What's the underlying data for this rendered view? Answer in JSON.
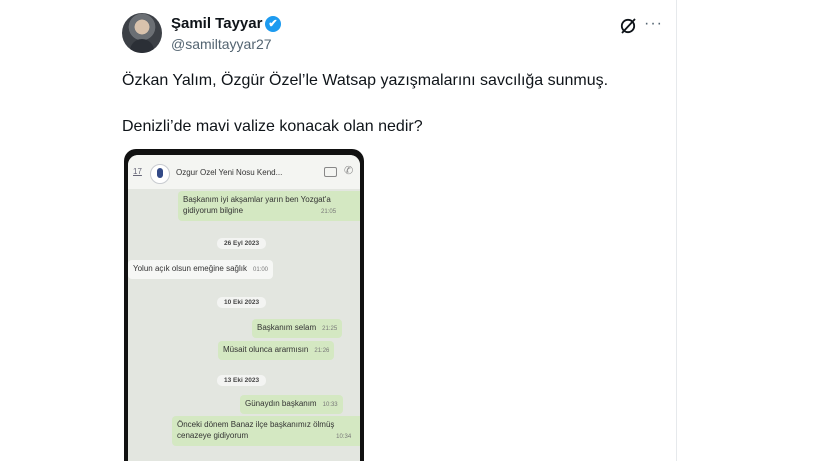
{
  "tweet": {
    "author_name": "Şamil Tayyar",
    "handle": "@samiltayyar27",
    "verified_mark": "✔",
    "more_label": "···",
    "text_line1": "Özkan Yalım, Özgür Özel’le Watsap yazışmalarını savcılığa sunmuş.",
    "text_line2": "Denizli’de mavi valize konacak olan nedir?"
  },
  "chat_screenshot": {
    "back_label": "17",
    "contact_title": "Ozgur Ozel Yeni Nosu Kend...",
    "messages": [
      {
        "kind": "out",
        "text1": "Başkanım iyi akşamlar yarın ben Yozgat'a",
        "text2": "gidiyorum bilgine",
        "time": "21:05"
      },
      {
        "kind": "date",
        "text": "26 Eyl 2023"
      },
      {
        "kind": "in",
        "text": "Yolun açık olsun emeğine sağlık",
        "time": "01:00"
      },
      {
        "kind": "date",
        "text": "10 Eki 2023"
      },
      {
        "kind": "out",
        "text": "Başkanım selam",
        "time": "21:25"
      },
      {
        "kind": "out",
        "text": "Müsait olunca ararmısın",
        "time": "21:26"
      },
      {
        "kind": "date",
        "text": "13 Eki 2023"
      },
      {
        "kind": "out",
        "text": "Günaydın başkanım",
        "time": "10:33"
      },
      {
        "kind": "out",
        "text1": "Önceki dönem Banaz ilçe başkanımız ölmüş",
        "text2": "cenazeye gidiyorum",
        "time": "10:34"
      }
    ]
  },
  "colors": {
    "verified_blue": "#1d9bf0",
    "outgoing_bubble": "#d4e8c2",
    "chat_background": "#e3e6e0"
  },
  "icons": [
    "grok-icon",
    "more-icon",
    "verified-badge-icon",
    "video-call-icon",
    "phone-icon"
  ]
}
